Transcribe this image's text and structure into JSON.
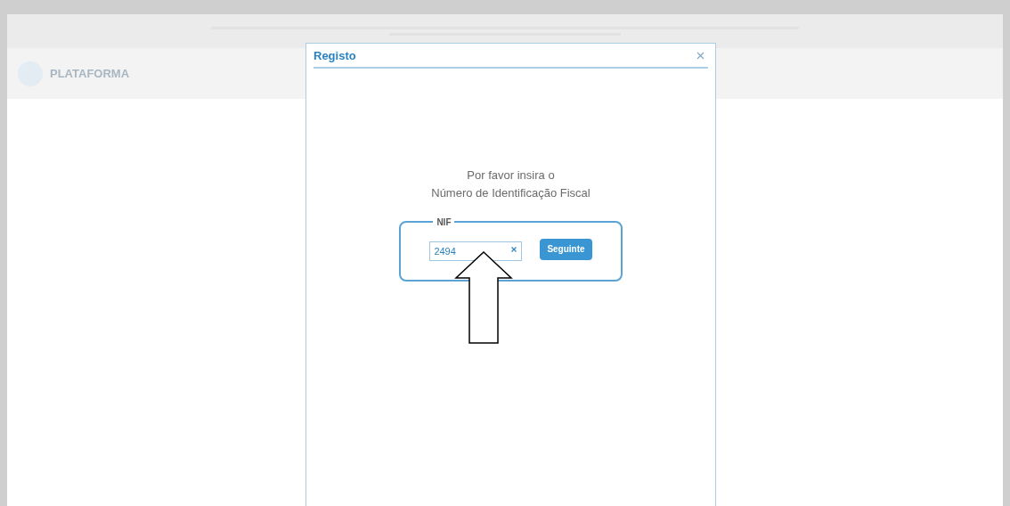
{
  "header": {
    "logo_text": "PLATAFORMA"
  },
  "dialog": {
    "title": "Registo",
    "prompt_lines": [
      "Por favor insira o",
      "Número de Identificação Fiscal"
    ],
    "group_label": "NIF",
    "nif_field": {
      "value": "2494"
    },
    "next_button": "Seguinte"
  }
}
